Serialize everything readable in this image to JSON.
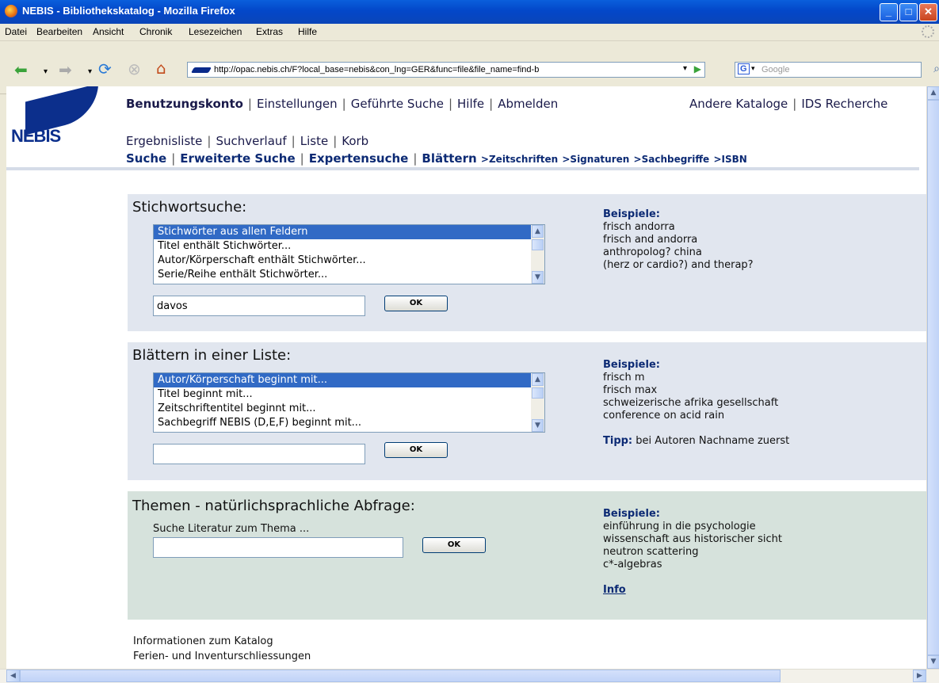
{
  "window": {
    "title": "NEBIS - Bibliothekskatalog - Mozilla Firefox"
  },
  "menu": [
    "Datei",
    "Bearbeiten",
    "Ansicht",
    "Chronik",
    "Lesezeichen",
    "Extras",
    "Hilfe"
  ],
  "browser": {
    "url": "http://opac.nebis.ch/F?local_base=nebis&con_lng=GER&func=file&file_name=find-b",
    "search_placeholder": "Google"
  },
  "logo": {
    "text": "NEBIS"
  },
  "topnav": {
    "account": "Benutzungskonto",
    "settings": "Einstellungen",
    "guided": "Geführte Suche",
    "help": "Hilfe",
    "logout": "Abmelden",
    "other_catalogs": "Andere Kataloge",
    "ids": "IDS Recherche"
  },
  "subnav": {
    "results": "Ergebnisliste",
    "history": "Suchverlauf",
    "list": "Liste",
    "basket": "Korb"
  },
  "searchnav": {
    "search": "Suche",
    "advanced": "Erweiterte Suche",
    "expert": "Expertensuche",
    "browse": "Blättern",
    "journals": ">Zeitschriften",
    "signatures": ">Signaturen",
    "subjects": ">Sachbegriffe",
    "isbn": ">ISBN"
  },
  "panels": {
    "keyword": {
      "title": "Stichwortsuche:",
      "options": [
        "Stichwörter aus allen Feldern",
        "Titel enthält Stichwörter...",
        "Autor/Körperschaft enthält Stichwörter...",
        "Serie/Reihe enthält Stichwörter..."
      ],
      "input_value": "davos",
      "ok": "OK",
      "examples_label": "Beispiele:",
      "examples": [
        "frisch andorra",
        "frisch and andorra",
        "anthropolog? china",
        "(herz or cardio?) and therap?"
      ]
    },
    "browse": {
      "title": "Blättern in einer Liste:",
      "options": [
        "Autor/Körperschaft beginnt mit...",
        "Titel beginnt mit...",
        "Zeitschriftentitel beginnt mit...",
        "Sachbegriff NEBIS (D,E,F) beginnt mit..."
      ],
      "input_value": "",
      "ok": "OK",
      "examples_label": "Beispiele:",
      "examples": [
        "frisch m",
        "frisch max",
        "schweizerische afrika gesellschaft",
        "conference on acid rain"
      ],
      "tip_label": "Tipp:",
      "tip_text": " bei Autoren Nachname zuerst"
    },
    "topics": {
      "title": "Themen - natürlichsprachliche Abfrage:",
      "sublabel": "Suche Literatur zum Thema ...",
      "input_value": "",
      "ok": "OK",
      "examples_label": "Beispiele:",
      "examples": [
        "einführung in die psychologie",
        "wissenschaft aus historischer sicht",
        "neutron scattering",
        "c*-algebras"
      ],
      "info": "Info"
    }
  },
  "footer": {
    "info": "Informationen zum Katalog",
    "holidays": "Ferien- und Inventurschliessungen"
  }
}
